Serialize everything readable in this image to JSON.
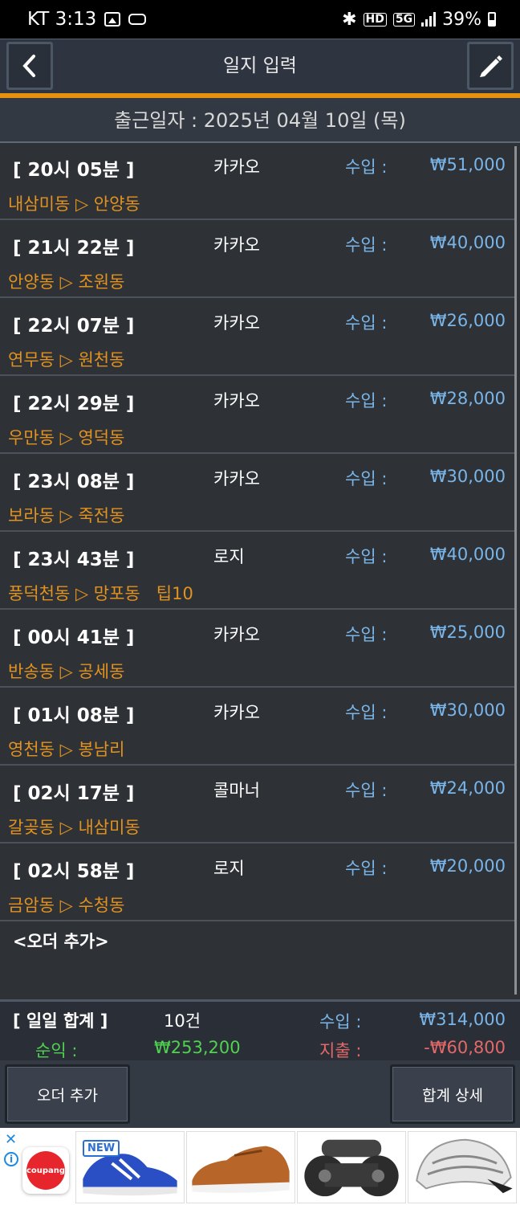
{
  "status_bar": {
    "carrier_time": "KT 3:13",
    "network": "5G",
    "hd": "HD",
    "battery": "39%"
  },
  "header": {
    "title": "일지 입력",
    "back_icon": "chevron-left-icon",
    "edit_icon": "pencil-icon"
  },
  "date_line": "출근일자 : 2025년 04월 10일 (목)",
  "income_label": "수입 :",
  "orders": [
    {
      "time": "[ 20시 05분 ]",
      "company": "카카오",
      "amount": "₩51,000",
      "route": "내삼미동 ▷ 안양동"
    },
    {
      "time": "[ 21시 22분 ]",
      "company": "카카오",
      "amount": "₩40,000",
      "route": "안양동 ▷ 조원동"
    },
    {
      "time": "[ 22시 07분 ]",
      "company": "카카오",
      "amount": "₩26,000",
      "route": "연무동 ▷ 원천동"
    },
    {
      "time": "[ 22시 29분 ]",
      "company": "카카오",
      "amount": "₩28,000",
      "route": "우만동 ▷ 영덕동"
    },
    {
      "time": "[ 23시 08분 ]",
      "company": "카카오",
      "amount": "₩30,000",
      "route": "보라동 ▷ 죽전동"
    },
    {
      "time": "[ 23시 43분 ]",
      "company": "로지",
      "amount": "₩40,000",
      "route": "풍덕천동 ▷ 망포동   팁10"
    },
    {
      "time": "[ 00시 41분 ]",
      "company": "카카오",
      "amount": "₩25,000",
      "route": "반송동 ▷ 공세동"
    },
    {
      "time": "[ 01시 08분 ]",
      "company": "카카오",
      "amount": "₩30,000",
      "route": "영천동 ▷ 봉남리"
    },
    {
      "time": "[ 02시 17분 ]",
      "company": "콜마너",
      "amount": "₩24,000",
      "route": "갈곶동 ▷ 내삼미동"
    },
    {
      "time": "[ 02시 58분 ]",
      "company": "로지",
      "amount": "₩20,000",
      "route": "금암동 ▷ 수청동"
    }
  ],
  "add_order_row": "<오더 추가>",
  "summary": {
    "title": "[ 일일 합계 ]",
    "count": "10건",
    "income_label": "수입 :",
    "income": "₩314,000",
    "net_label": "순익 :",
    "net": "₩253,200",
    "expense_label": "지출 :",
    "expense": "-₩60,800"
  },
  "buttons": {
    "add_order": "오더 추가",
    "total_detail": "합계 상세"
  },
  "ad": {
    "close": "✕",
    "info": "i",
    "brand": "coupang",
    "new_badge": "NEW"
  },
  "colors": {
    "accent_orange": "#e8900f",
    "route_orange": "#e2921e",
    "income_blue": "#79b5e8",
    "net_green": "#4fd24f",
    "expense_red": "#e46868"
  }
}
